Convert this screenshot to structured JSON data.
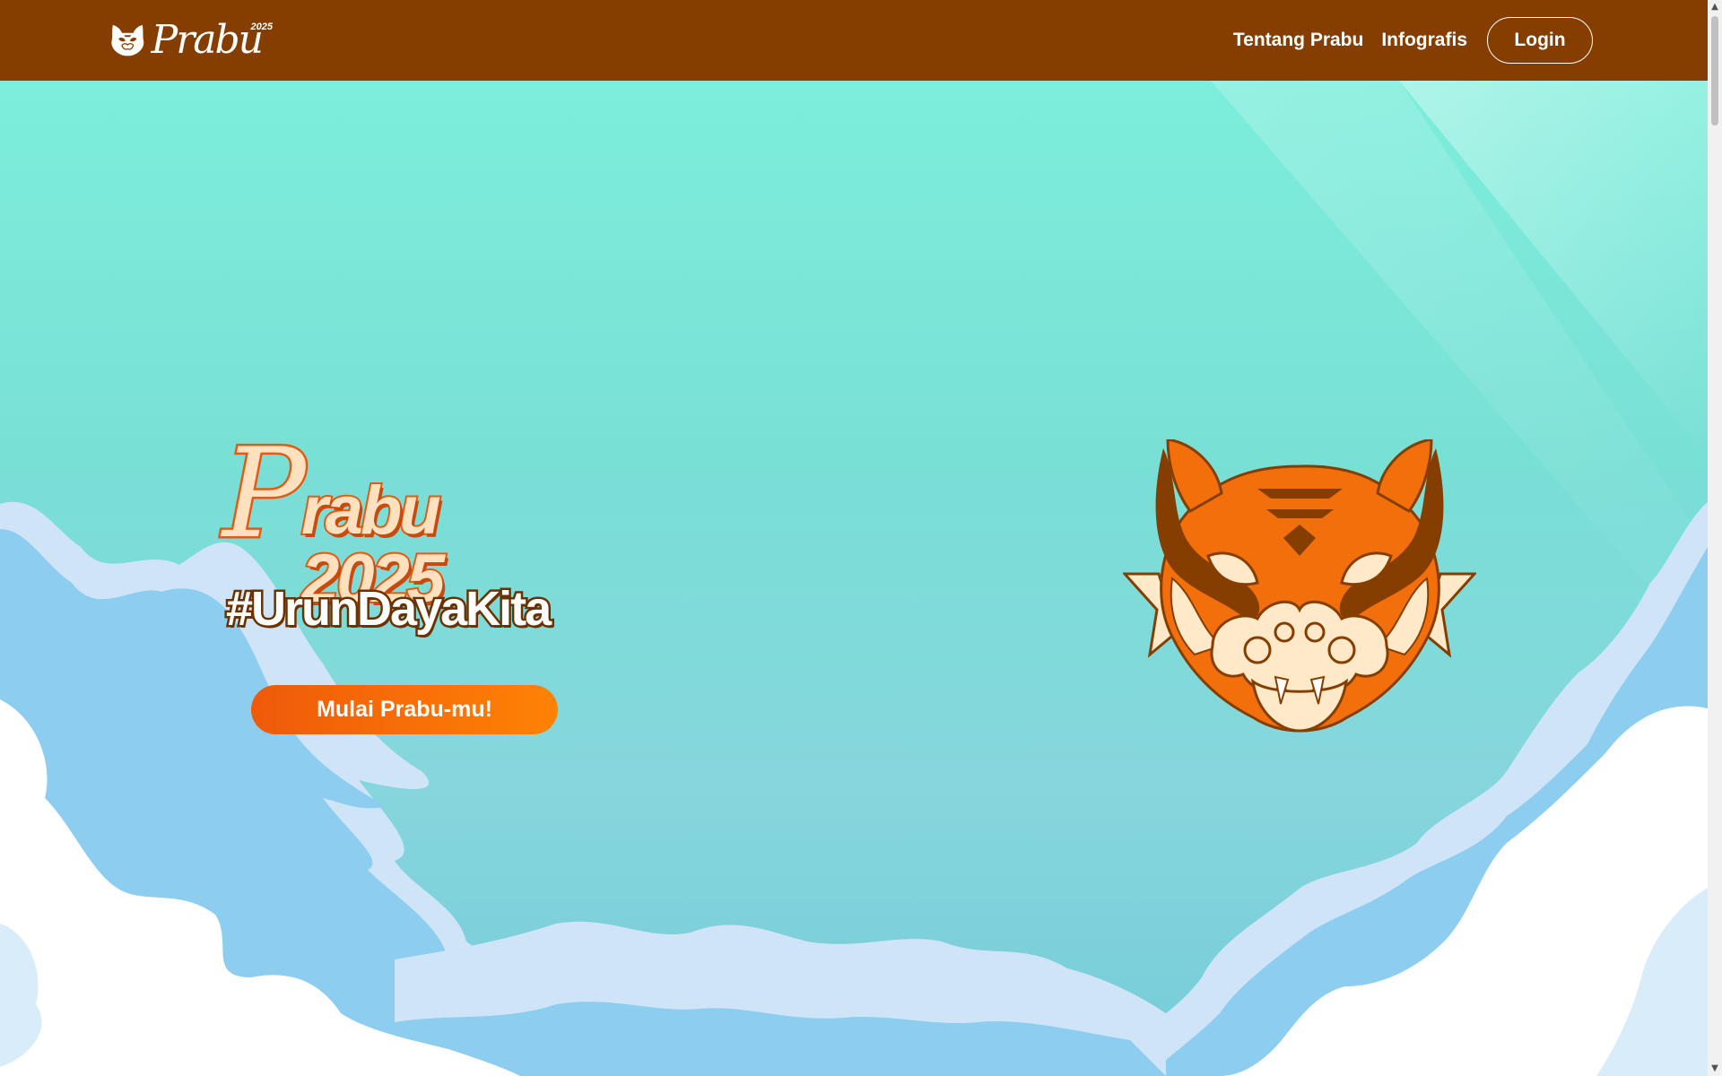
{
  "brand": {
    "wordmark": "Prabu",
    "year": "2025",
    "logo_icon": "tiger-mask-icon"
  },
  "nav": {
    "links": [
      {
        "label": "Tentang Prabu"
      },
      {
        "label": "Infografis"
      }
    ],
    "login_label": "Login"
  },
  "hero": {
    "title_initial": "P",
    "title_rest": "rabu 2025",
    "tagline": "#UrunDayaKita",
    "cta_label": "Mulai Prabu-mu!",
    "mascot_icon": "tiger-mask-icon"
  },
  "colors": {
    "navbar": "#853e00",
    "sky": "#7deedb",
    "cta_start": "#ef5a0a",
    "cta_end": "#ff8205",
    "cloud_blue": "#8ccdf0",
    "cloud_light": "#d4e8f8",
    "tiger_orange": "#f26f0c",
    "tiger_brown": "#853e00",
    "tiger_cream": "#ffe9c8"
  },
  "scrollbar": {
    "up_icon": "chevron-up-icon",
    "down_icon": "chevron-down-icon"
  }
}
